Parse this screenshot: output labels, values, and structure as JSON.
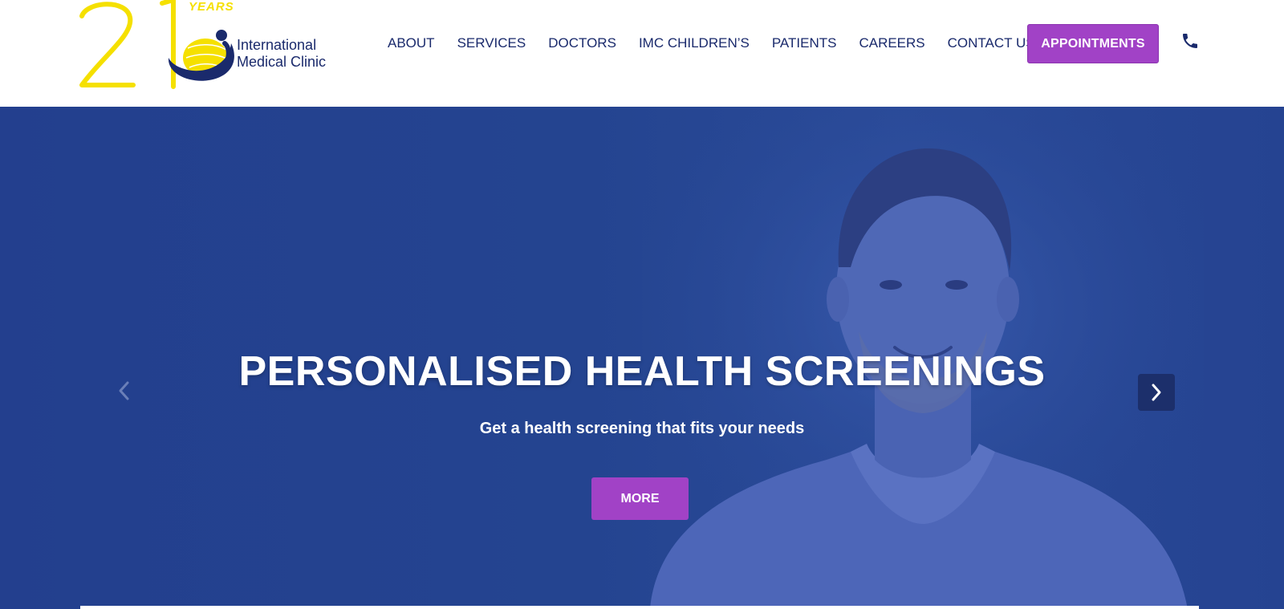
{
  "brand": {
    "anniversary_number": "21",
    "anniversary_label": "YEARS",
    "name_line1": "International",
    "name_line2": "Medical Clinic",
    "colors": {
      "yellow": "#f5e000",
      "navy": "#1a2a6c"
    }
  },
  "nav": {
    "items": [
      {
        "label": "ABOUT"
      },
      {
        "label": "SERVICES"
      },
      {
        "label": "DOCTORS"
      },
      {
        "label": "IMC CHILDREN’S"
      },
      {
        "label": "PATIENTS"
      },
      {
        "label": "CAREERS"
      },
      {
        "label": "CONTACT US"
      }
    ],
    "appointments_label": "APPOINTMENTS",
    "phone_icon": "phone-icon"
  },
  "hero": {
    "title": "PERSONALISED HEALTH SCREENINGS",
    "subtitle": "Get a health screening that fits your needs",
    "cta_label": "MORE",
    "prev_icon": "chevron-left-icon",
    "next_icon": "chevron-right-icon",
    "colors": {
      "background": "#244490",
      "accent": "#a142c6"
    }
  }
}
